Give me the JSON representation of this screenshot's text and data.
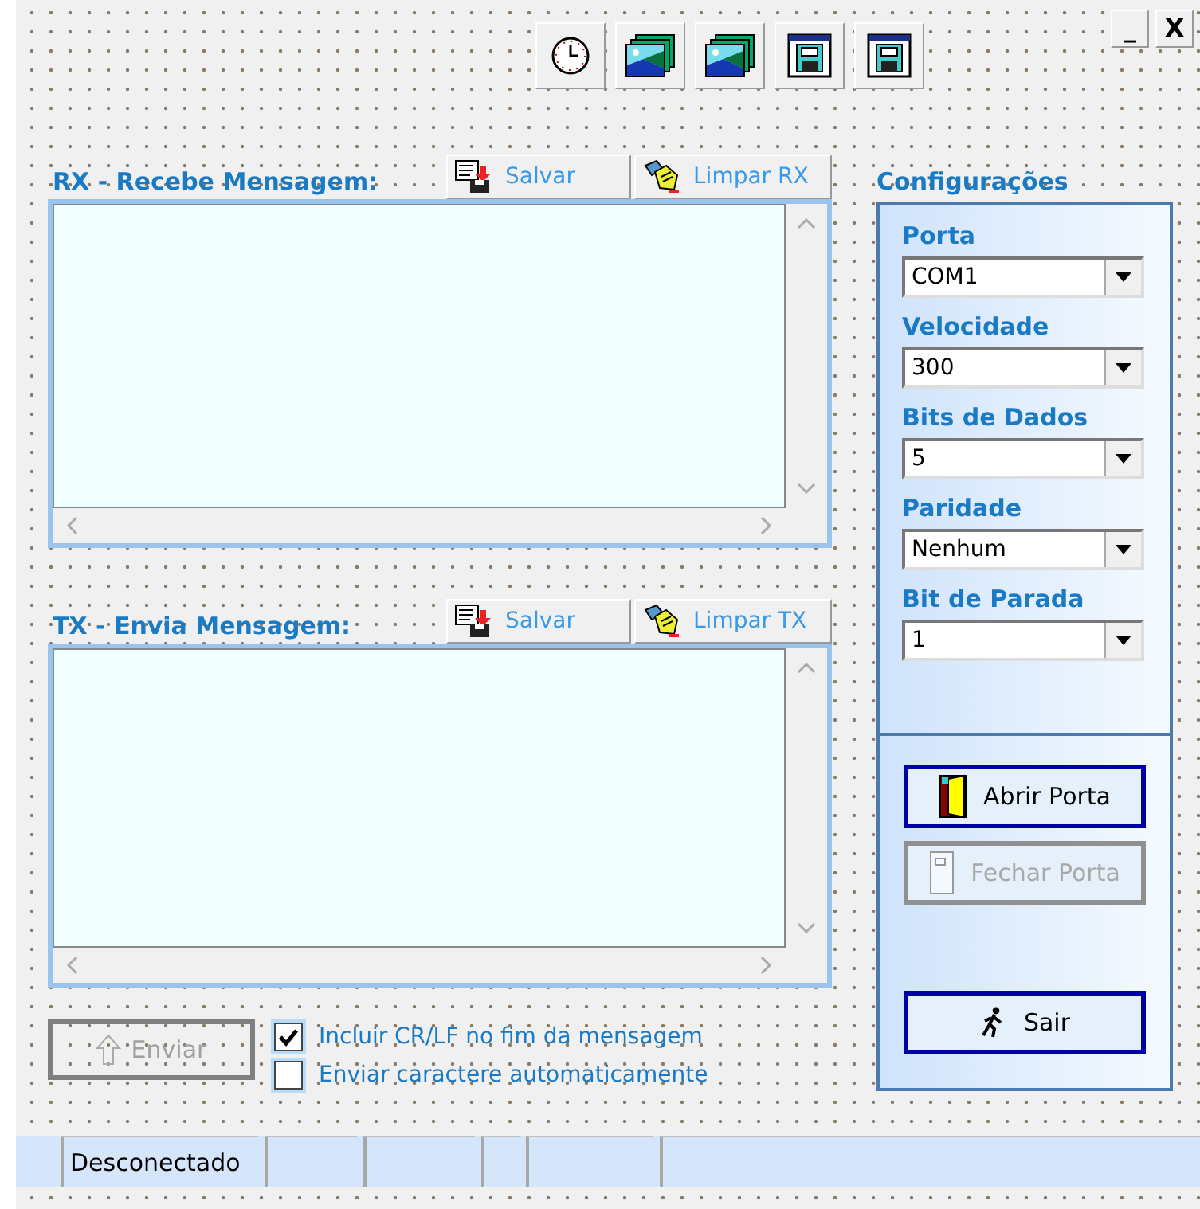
{
  "toolbar": [
    {
      "kind": "clock"
    },
    {
      "kind": "pictures"
    },
    {
      "kind": "pictures"
    },
    {
      "kind": "window-disk"
    },
    {
      "kind": "window-disk"
    }
  ],
  "window_buttons": [
    "_",
    "X"
  ],
  "rx": {
    "title": "RX - Recebe Mensagem:",
    "buttons": [
      {
        "kind": "save",
        "label": "Salvar"
      },
      {
        "kind": "clear",
        "label": "Limpar RX"
      }
    ]
  },
  "tx": {
    "title": "TX - Envia Mensagem:",
    "buttons": [
      {
        "kind": "save",
        "label": "Salvar"
      },
      {
        "kind": "clear",
        "label": "Limpar TX"
      }
    ]
  },
  "send_button": {
    "label": "Enviar",
    "disabled": true
  },
  "options": [
    {
      "label": "Incluir CR/LF no fim da mensagem",
      "checked": true
    },
    {
      "label": "Enviar caractere automaticamente",
      "checked": false
    }
  ],
  "config": {
    "title": "Configurações",
    "fields": [
      {
        "label": "Porta",
        "value": "COM1"
      },
      {
        "label": "Velocidade",
        "value": "300"
      },
      {
        "label": "Bits de Dados",
        "value": "5"
      },
      {
        "label": "Paridade",
        "value": "Nenhum"
      },
      {
        "label": "Bit de Parada",
        "value": "1"
      }
    ],
    "buttons": [
      {
        "kind": "open",
        "label": "Abrir Porta",
        "disabled": false
      },
      {
        "kind": "close",
        "label": "Fechar Porta",
        "disabled": true
      },
      {
        "kind": "exit",
        "label": "Sair",
        "disabled": false
      }
    ]
  },
  "status_bar": {
    "text": "Desconectado"
  }
}
